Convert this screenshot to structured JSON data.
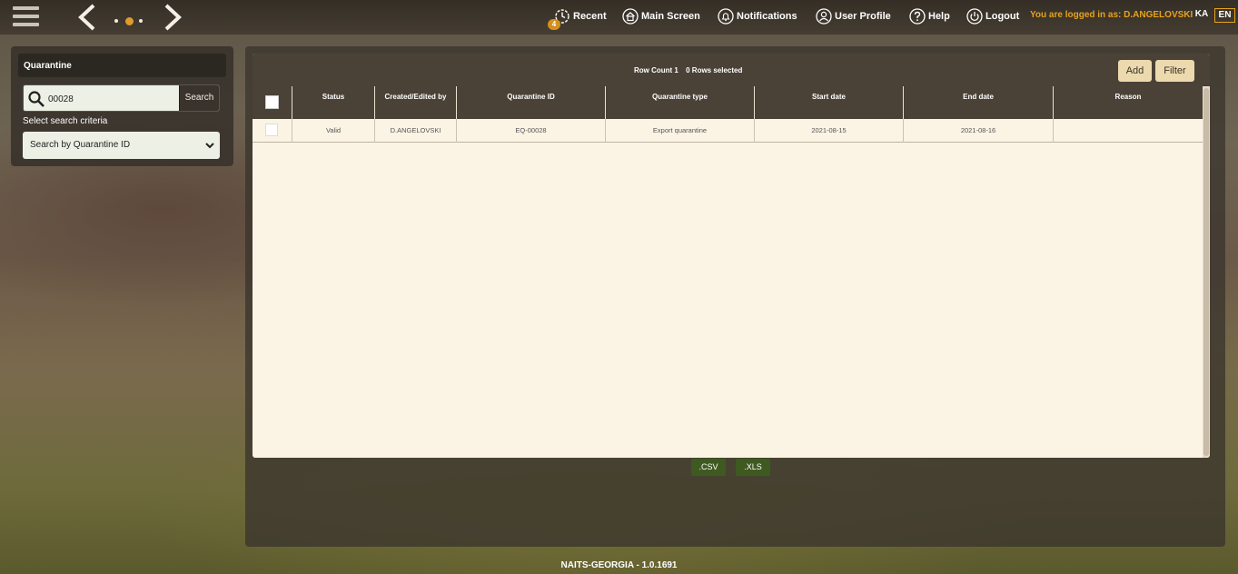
{
  "topbar": {
    "menu": {
      "recent": "Recent",
      "recent_badge": "4",
      "main_screen": "Main Screen",
      "notifications": "Notifications",
      "user_profile": "User Profile",
      "help": "Help",
      "logout": "Logout"
    },
    "logged_in_text": "You are logged in as: D.ANGELOVSKI",
    "languages": [
      "KA",
      "EN"
    ],
    "active_language": "EN"
  },
  "search_panel": {
    "title": "Quarantine",
    "search_value": "00028",
    "search_button": "Search",
    "criteria_label": "Select search criteria",
    "criteria_selected": "Search by Quarantine ID"
  },
  "grid": {
    "row_count_label": "Row Count 1",
    "rows_selected_label": "0 Rows selected",
    "add_button": "Add",
    "filter_button": "Filter",
    "columns": [
      "Status",
      "Created/Edited by",
      "Quarantine ID",
      "Quarantine type",
      "Start date",
      "End date",
      "Reason"
    ],
    "rows": [
      {
        "status": "Valid",
        "created_by": "D.ANGELOVSKI",
        "quarantine_id": "EQ-00028",
        "quarantine_type": "Export quarantine",
        "start_date": "2021-08-15",
        "end_date": "2021-08-16",
        "reason": ""
      }
    ]
  },
  "export": {
    "csv": ".CSV",
    "xls": ".XLS"
  },
  "footer": "NAITS-GEORGIA - 1.0.1691",
  "colors": {
    "accent_orange": "#e7a21c",
    "badge": "#d2901d",
    "grid_bg": "#fbf3e4",
    "header_bg": "#4a4137",
    "button_bg": "#ecd9ad",
    "export_bg": "#3f5a20"
  }
}
